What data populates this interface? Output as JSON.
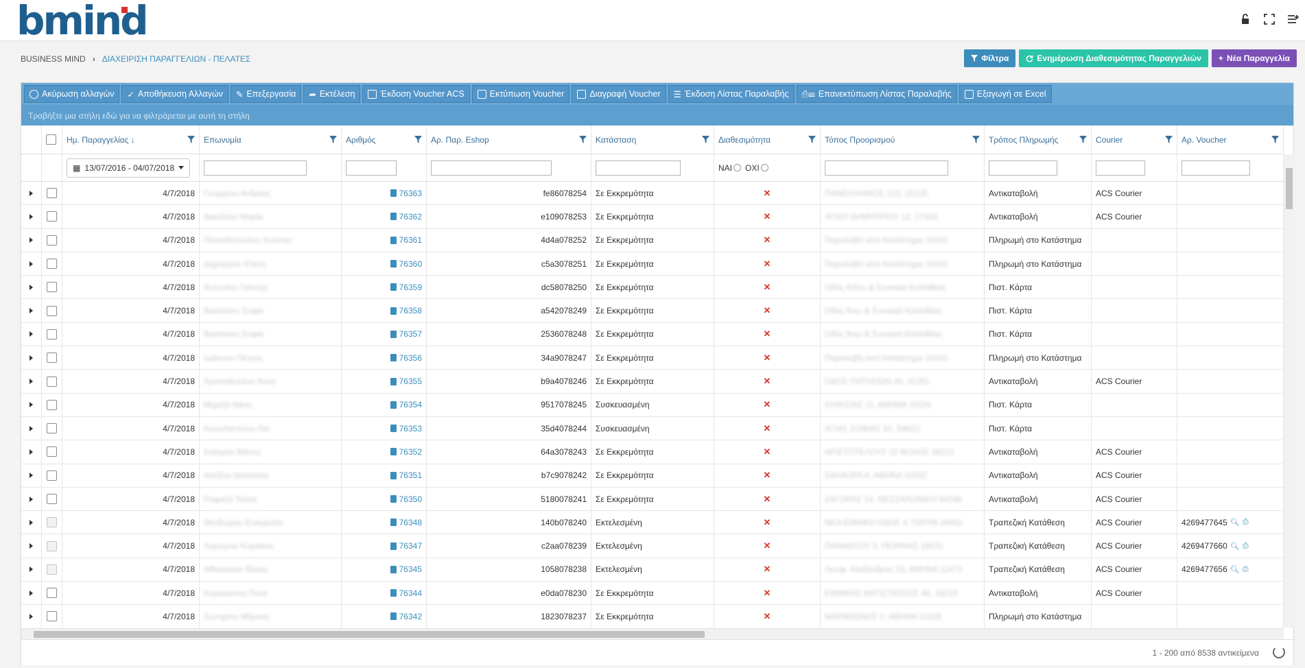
{
  "app": {
    "logo": "bmind"
  },
  "breadcrumb": {
    "root": "BUSINESS MIND",
    "current": "ΔΙΑΧΕΙΡΙΣΗ ΠΑΡΑΓΓΕΛΙΩΝ - ΠΕΛΑΤΕΣ"
  },
  "actions": {
    "filter": "Φίλτρα",
    "update": "Ενημέρωση Διαθεσιμότητας Παραγγελιών",
    "new_order": "Νέα Παραγγελία"
  },
  "toolbar": [
    "Ακύρωση αλλαγών",
    "Αποθήκευση Αλλαγών",
    "Επεξεργασία",
    "Εκτέλεση",
    "Έκδοση Voucher ACS",
    "Εκτύπωση Voucher",
    "Διαγραφή Voucher",
    "Έκδοση Λίστας Παραλαβής",
    "Επανεκτύπωση Λίστας Παραλαβής",
    "Εξαγωγή σε Excel"
  ],
  "group_hint": "Τραβήξτε μια στήλη εδώ για να φιλτράρεται με αυτή τη στήλη",
  "columns": {
    "date": "Ημ. Παραγγελίας",
    "name": "Επωνυμία",
    "number": "Αριθμός",
    "eshop": "Αρ. Παρ. Eshop",
    "status": "Κατάσταση",
    "availability": "Διαθεσιμότητα",
    "destination": "Τόπος Προορισμού",
    "payment": "Τρόπος Πληρωμής",
    "courier": "Courier",
    "voucher": "Αρ. Voucher"
  },
  "filters": {
    "date_range": "13/07/2016 - 04/07/2018",
    "yes": "ΝΑΙ",
    "no": "ΟΧΙ"
  },
  "rows": [
    {
      "date": "4/7/2018",
      "name": "Γεωργίου Ανδρέας",
      "number": "76363",
      "eshop": "fe86078254",
      "status": "Σε Εκκρεμότητα",
      "dest": "ΠΑΝΕΛΛΗΝΙΟΣ 123, 15125",
      "payment": "Αντικαταβολή",
      "courier": "ACS Courier",
      "voucher": "",
      "disabled": false
    },
    {
      "date": "4/7/2018",
      "name": "Νικολάου Μαρία",
      "number": "76362",
      "eshop": "e109078253",
      "status": "Σε Εκκρεμότητα",
      "dest": "ΑΓΙΟΥ ΔΗΜΗΤΡΙΟΥ 12, 17343",
      "payment": "Αντικαταβολή",
      "courier": "ACS Courier",
      "voucher": "",
      "disabled": false
    },
    {
      "date": "4/7/2018",
      "name": "Παπαδόπουλος Κώστας",
      "number": "76361",
      "eshop": "4d4a078252",
      "status": "Σε Εκκρεμότητα",
      "dest": "Παραλαβή από Κατάστημα 10431",
      "payment": "Πληρωμή στο Κατάστημα",
      "courier": "",
      "voucher": "",
      "disabled": false
    },
    {
      "date": "4/7/2018",
      "name": "Δημητρίου Ελένη",
      "number": "76360",
      "eshop": "c5a3078251",
      "status": "Σε Εκκρεμότητα",
      "dest": "Παραλαβή από Κατάστημα 10431",
      "payment": "Πληρωμή στο Κατάστημα",
      "courier": "",
      "voucher": "",
      "disabled": false
    },
    {
      "date": "4/7/2018",
      "name": "Αντωνίου Γιάννης",
      "number": "76359",
      "eshop": "dc58078250",
      "status": "Σε Εκκρεμότητα",
      "dest": "Οδός Κάτω & Συνοικία Καλλιθέας",
      "payment": "Πιστ. Κάρτα",
      "courier": "",
      "voucher": "",
      "disabled": false
    },
    {
      "date": "4/7/2018",
      "name": "Βασιλείου Σοφία",
      "number": "76358",
      "eshop": "a542078249",
      "status": "Σε Εκκρεμότητα",
      "dest": "Οδός Άνω & Συνοικία Καλλιθέας",
      "payment": "Πιστ. Κάρτα",
      "courier": "",
      "voucher": "",
      "disabled": false
    },
    {
      "date": "4/7/2018",
      "name": "Βασιλείου Σοφία",
      "number": "76357",
      "eshop": "2536078248",
      "status": "Σε Εκκρεμότητα",
      "dest": "Οδός Άνω & Συνοικία Καλλιθέας",
      "payment": "Πιστ. Κάρτα",
      "courier": "",
      "voucher": "",
      "disabled": false
    },
    {
      "date": "4/7/2018",
      "name": "Ιωάννου Πέτρος",
      "number": "76356",
      "eshop": "34a9078247",
      "status": "Σε Εκκρεμότητα",
      "dest": "Παραλαβή από Κατάστημα 10431",
      "payment": "Πληρωμή στο Κατάστημα",
      "courier": "",
      "voucher": "",
      "disabled": false
    },
    {
      "date": "4/7/2018",
      "name": "Χριστοδούλου Άννα",
      "number": "76355",
      "eshop": "b9a4078246",
      "status": "Σε Εκκρεμότητα",
      "dest": "ΟΔΟΣ ΠΑΤΗΣΙΩΝ 45, 11251",
      "payment": "Αντικαταβολή",
      "courier": "ACS Courier",
      "voucher": "",
      "disabled": false
    },
    {
      "date": "4/7/2018",
      "name": "Μιχαήλ Νίκος",
      "number": "76354",
      "eshop": "9517078245",
      "status": "Συσκευασμένη",
      "dest": "ΚΗΦΙΣΙΑΣ 11, ΑΘΗΝΑ 11526",
      "payment": "Πιστ. Κάρτα",
      "courier": "",
      "voucher": "",
      "disabled": false
    },
    {
      "date": "4/7/2018",
      "name": "Κωνσταντίνου Λία",
      "number": "76353",
      "eshop": "35d4078244",
      "status": "Συσκευασμένη",
      "dest": "ΑΓΙΑΣ ΣΟΦΙΑΣ 52, 54622",
      "payment": "Πιστ. Κάρτα",
      "courier": "",
      "voucher": "",
      "disabled": false
    },
    {
      "date": "4/7/2018",
      "name": "Σταύρου Μάνος",
      "number": "76352",
      "eshop": "64a3078243",
      "status": "Σε Εκκρεμότητα",
      "dest": "ΑΡΙΣΤΟΤΕΛΟΥΣ 22 ΒΟΛΟΣ 38221",
      "payment": "Αντικαταβολή",
      "courier": "ACS Courier",
      "voucher": "",
      "disabled": false
    },
    {
      "date": "4/7/2018",
      "name": "Αλεξίου Δέσποινα",
      "number": "76351",
      "eshop": "b7c9078242",
      "status": "Σε Εκκρεμότητα",
      "dest": "ΣΑΛΑΟΡΑ 8, ΑΘΗΝΑ 11632",
      "payment": "Αντικαταβολή",
      "courier": "ACS Courier",
      "voucher": "",
      "disabled": false
    },
    {
      "date": "4/7/2018",
      "name": "Ραφαήλ Τάσος",
      "number": "76350",
      "eshop": "5180078241",
      "status": "Σε Εκκρεμότητα",
      "dest": "ΖΑΓΟΡΑΣ 14, ΘΕΣΣΑΛΟΝΙΚΗ 54248",
      "payment": "Αντικαταβολή",
      "courier": "ACS Courier",
      "voucher": "",
      "disabled": false
    },
    {
      "date": "4/7/2018",
      "name": "Θεοδώρου Ευαγγελία",
      "number": "76348",
      "eshop": "140b078240",
      "status": "Εκτελεσμένη",
      "dest": "ΝΕΑ ΕΘΝΙΚΗ ΟΔΟΣ 4, ΠΑΤΡΑ 26441",
      "payment": "Τραπεζική Κατάθεση",
      "courier": "ACS Courier",
      "voucher": "4269477645",
      "disabled": true
    },
    {
      "date": "4/7/2018",
      "name": "Λαμπρου Κυριάκος",
      "number": "76347",
      "eshop": "c2aa078239",
      "status": "Εκτελεσμένη",
      "dest": "ΠΑΝΑΝΤΟΥ 3, ΠΕΙΡΑΙΑΣ 18531",
      "payment": "Τραπεζική Κατάθεση",
      "courier": "ACS Courier",
      "voucher": "4269477660",
      "disabled": true
    },
    {
      "date": "4/7/2018",
      "name": "Αθανασίου Βάσω",
      "number": "76345",
      "eshop": "1058078238",
      "status": "Εκτελεσμένη",
      "dest": "Λεωφ. Αλεξάνδρας 33, ΑΘΗΝΑ 11473",
      "payment": "Τραπεζική Κατάθεση",
      "courier": "ACS Courier",
      "voucher": "4269477656",
      "disabled": true
    },
    {
      "date": "4/7/2018",
      "name": "Καραγιάννη Ρένα",
      "number": "76344",
      "eshop": "e0da078230",
      "status": "Σε Εκκρεμότητα",
      "dest": "ΕΘΝΙΚΗΣ ΑΝΤΙΣΤΑΣΕΩΣ 40, 16233",
      "payment": "Αντικαταβολή",
      "courier": "ACS Courier",
      "voucher": "",
      "disabled": false
    },
    {
      "date": "4/7/2018",
      "name": "Σωτηρίου Μάρκος",
      "number": "76342",
      "eshop": "1823078237",
      "status": "Σε Εκκρεμότητα",
      "dest": "ΜΑΡΑΘΩΝΟΣ 2, ΑΘΗΝΑ 11526",
      "payment": "Πληρωμή στο Κατάστημα",
      "courier": "",
      "voucher": "",
      "disabled": false
    }
  ],
  "pager": "1 - 200 από 8538 αντικείμενα",
  "colors": {
    "primary": "#3c8dbc",
    "teal": "#2bc4a8",
    "purple": "#7a4fb6",
    "toolbar": "#6aa9d6",
    "error": "#d8362a"
  }
}
